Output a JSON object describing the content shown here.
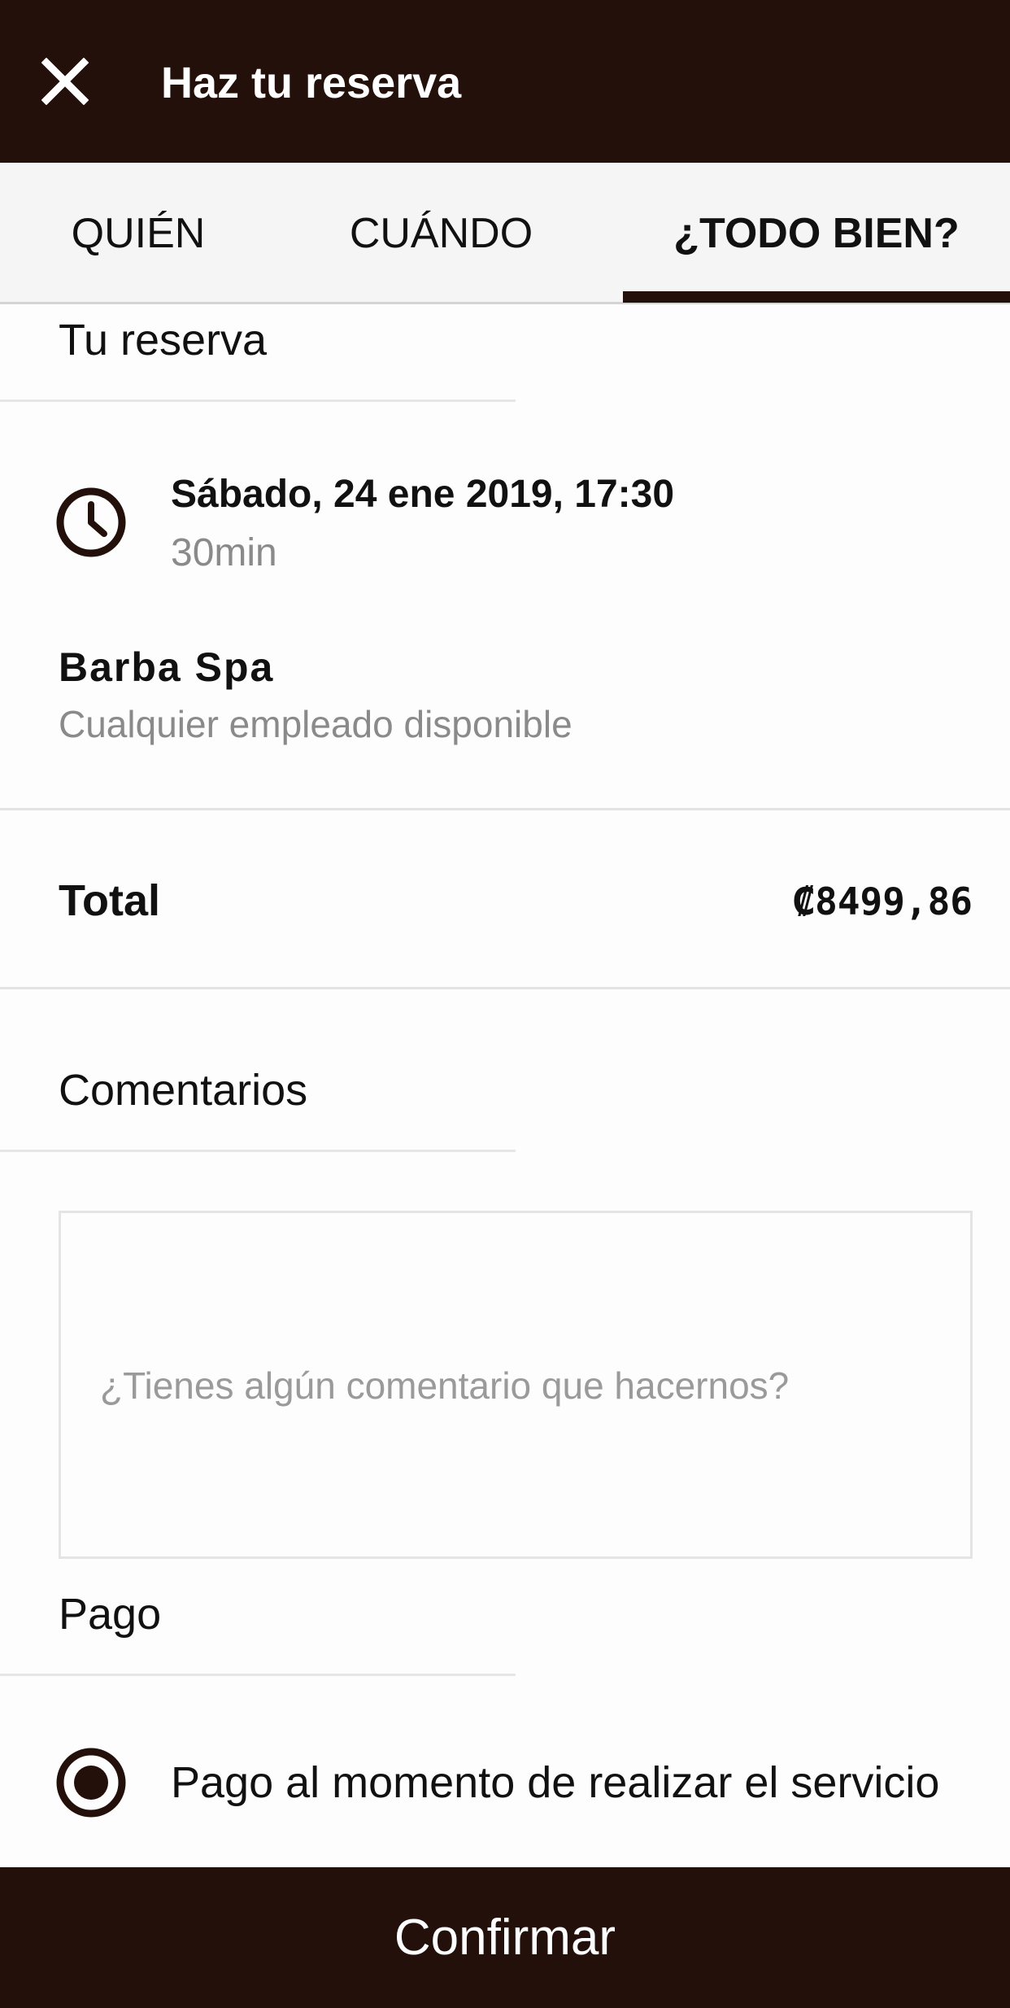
{
  "header": {
    "title": "Haz tu reserva",
    "close_icon": "close-icon"
  },
  "tabs": [
    {
      "label": "QUIÉN",
      "active": false
    },
    {
      "label": "CUÁNDO",
      "active": false
    },
    {
      "label": "¿TODO BIEN?",
      "active": true
    }
  ],
  "booking": {
    "section_title": "Tu reserva",
    "date_time": "Sábado, 24 ene 2019, 17:30",
    "duration": "30min",
    "service": "Barba Spa",
    "staff": "Cualquier empleado disponible",
    "clock_icon": "clock-icon"
  },
  "total": {
    "label": "Total",
    "value": "₡8499,86"
  },
  "comments": {
    "section_title": "Comentarios",
    "value": "",
    "placeholder": "¿Tienes algún comentario que hacernos?"
  },
  "payment": {
    "section_title": "Pago",
    "option_label": "Pago al momento de realizar el servicio",
    "selected": true
  },
  "footer": {
    "confirm_label": "Confirmar"
  },
  "colors": {
    "primary_dark": "#23100b",
    "muted_text": "#8a8a8a",
    "background": "#fdfdfd"
  }
}
